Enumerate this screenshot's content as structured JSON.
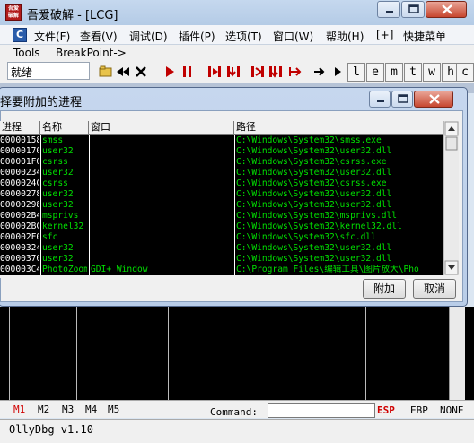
{
  "main": {
    "app_icon_text": "吾爱破解",
    "title": "吾爱破解 - [LCG]",
    "menu": [
      "文件(F)",
      "查看(V)",
      "调试(D)",
      "插件(P)",
      "选项(T)",
      "窗口(W)",
      "帮助(H)",
      "[+]",
      "快捷菜单"
    ],
    "menu_logo": "C",
    "tools_label": "Tools",
    "breakpoint_label": "BreakPoint->",
    "status": "就绪",
    "letter_buttons": [
      "l",
      "e",
      "m",
      "t",
      "w",
      "h",
      "c"
    ]
  },
  "dialog": {
    "title": "择要附加的进程",
    "columns": [
      "进程",
      "名称",
      "窗口",
      "路径"
    ],
    "rows": [
      {
        "pid": "00000158",
        "name": "smss",
        "window": "",
        "path": "C:\\Windows\\System32\\smss.exe"
      },
      {
        "pid": "00000170",
        "name": "user32",
        "window": "",
        "path": "C:\\Windows\\System32\\user32.dll"
      },
      {
        "pid": "000001F0",
        "name": "csrss",
        "window": "",
        "path": "C:\\Windows\\System32\\csrss.exe"
      },
      {
        "pid": "00000234",
        "name": "user32",
        "window": "",
        "path": "C:\\Windows\\System32\\user32.dll"
      },
      {
        "pid": "0000024C",
        "name": "csrss",
        "window": "",
        "path": "C:\\Windows\\System32\\csrss.exe"
      },
      {
        "pid": "00000278",
        "name": "user32",
        "window": "",
        "path": "C:\\Windows\\System32\\user32.dll"
      },
      {
        "pid": "00000298",
        "name": "user32",
        "window": "",
        "path": "C:\\Windows\\System32\\user32.dll"
      },
      {
        "pid": "000002B4",
        "name": "msprivs",
        "window": "",
        "path": "C:\\Windows\\System32\\msprivs.dll"
      },
      {
        "pid": "000002BC",
        "name": "kernel32",
        "window": "",
        "path": "C:\\Windows\\System32\\kernel32.dll"
      },
      {
        "pid": "000002F0",
        "name": "sfc",
        "window": "",
        "path": "C:\\Windows\\System32\\sfc.dll"
      },
      {
        "pid": "00000324",
        "name": "user32",
        "window": "",
        "path": "C:\\Windows\\System32\\user32.dll"
      },
      {
        "pid": "00000370",
        "name": "user32",
        "window": "",
        "path": "C:\\Windows\\System32\\user32.dll"
      },
      {
        "pid": "000003C4",
        "name": "PhotoZoom",
        "window": "GDI+ Window",
        "path": "C:\\Program Files\\编辑工具\\图片放大\\Pho"
      }
    ],
    "attach_button": "附加",
    "cancel_button": "取消"
  },
  "bottom": {
    "mem_tabs": [
      "M1",
      "M2",
      "M3",
      "M4",
      "M5"
    ],
    "command_label": "Command:",
    "command_value": "",
    "esp": "ESP",
    "ebp": "EBP",
    "none": "NONE",
    "version": "OllyDbg v1.10"
  },
  "colors": {
    "table_bg": "#000000",
    "pid_text": "#ffffff",
    "green_text": "#00e000",
    "esp_red": "#d00000",
    "active_tab_red": "#d00000"
  }
}
